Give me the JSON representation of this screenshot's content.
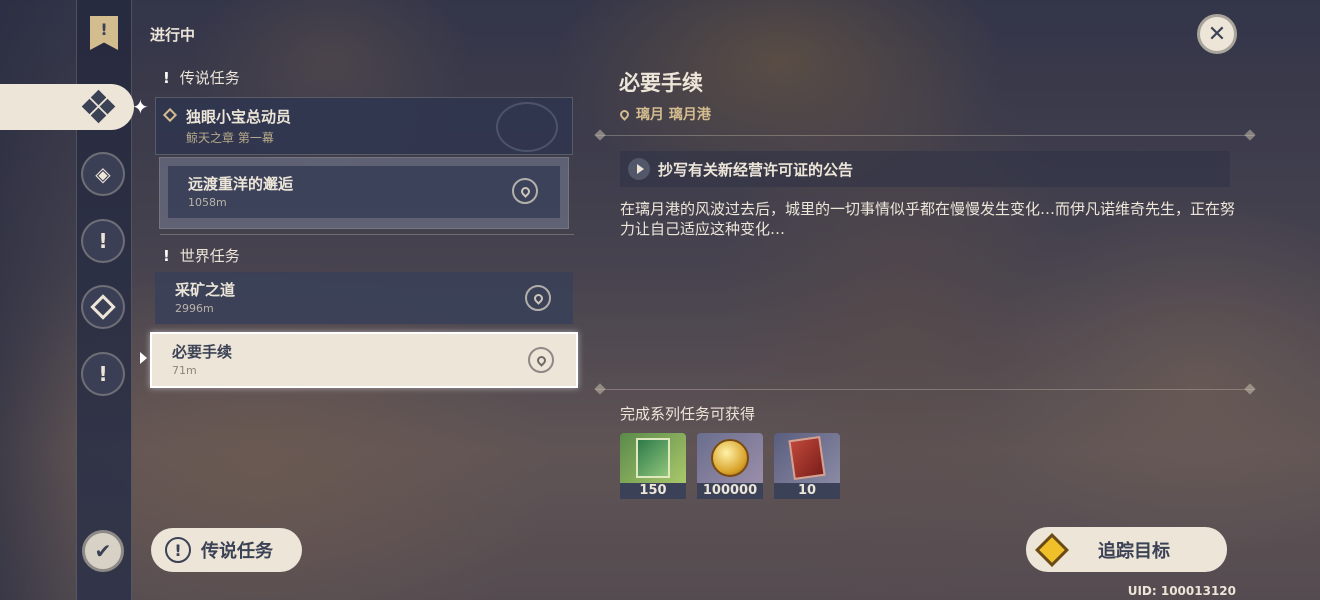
{
  "header": {
    "in_progress_label": "进行中"
  },
  "sections": {
    "legend_label": "传说任务",
    "world_label": "世界任务"
  },
  "legend_quest": {
    "title": "独眼小宝总动员",
    "subtitle": "鲸天之章 第一幕",
    "sub_quest": {
      "title": "远渡重洋的邂逅",
      "distance": "1058m"
    }
  },
  "world_quests": [
    {
      "title": "采矿之道",
      "distance": "2996m"
    },
    {
      "title": "必要手续",
      "distance": "71m",
      "selected": true
    }
  ],
  "detail": {
    "title": "必要手续",
    "location": "璃月 璃月港",
    "step": "抄写有关新经营许可证的公告",
    "description": "在璃月港的风波过去后，城里的一切事情似乎都在慢慢发生变化…而伊凡诺维奇先生，正在努力让自己适应这种变化…",
    "rewards_label": "完成系列任务可获得",
    "rewards": [
      {
        "icon": "hero-wit-book-icon",
        "count": "150"
      },
      {
        "icon": "mora-coin-icon",
        "count": "100000"
      },
      {
        "icon": "red-card-icon",
        "count": "10"
      }
    ]
  },
  "buttons": {
    "legend_quests": "传说任务",
    "track": "追踪目标"
  },
  "uid": "UID: 100013120"
}
